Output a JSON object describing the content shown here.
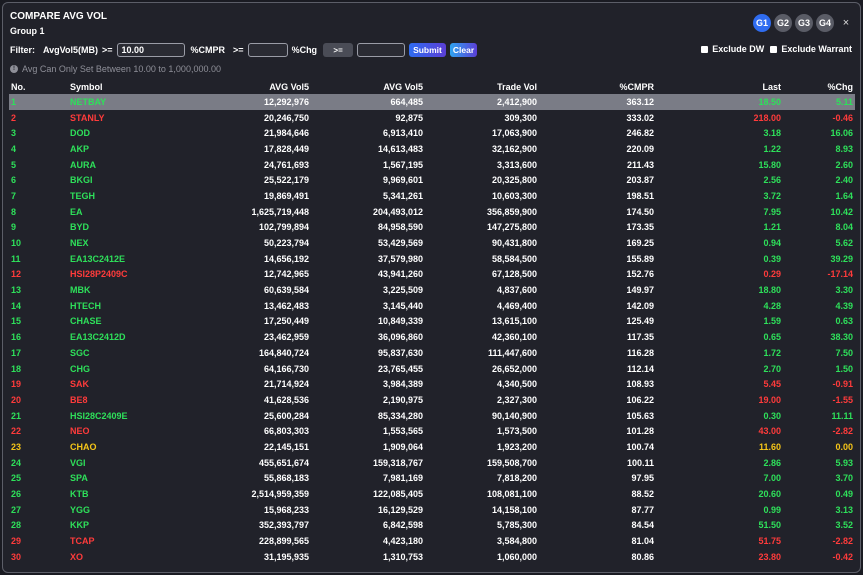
{
  "title": "COMPARE AVG VOL",
  "subtitle": "Group 1",
  "groups": [
    "G1",
    "G2",
    "G3",
    "G4"
  ],
  "close_icon": "×",
  "filter": {
    "label": "Filter:",
    "field1": "AvgVol5(MB)",
    "op1": ">=",
    "value1": "10.00",
    "field2": "%CMPR",
    "op2": ">=",
    "value2": "",
    "field3": "%Chg",
    "op3_btn": ">=",
    "value3": "",
    "submit": "Submit",
    "clear": "Clear"
  },
  "checks": {
    "dw": "Exclude DW",
    "warrant": "Exclude Warrant"
  },
  "hint": "Avg Can Only Set Between 10.00 to 1,000,000.00",
  "columns": [
    "No.",
    "Symbol",
    "AVG Vol5",
    "AVG Vol5",
    "Trade Vol",
    "%CMPR",
    "Last",
    "%Chg"
  ],
  "colors": {
    "up": "#2ee05a",
    "down": "#ff3b3b",
    "flat": "#f5c518"
  },
  "rows": [
    {
      "no": "1",
      "sym": "NETBAY",
      "a": "12,292,976",
      "b": "664,485",
      "t": "2,412,900",
      "c": "363.12",
      "last": "18.50",
      "chg": "5.11",
      "dir": "up"
    },
    {
      "no": "2",
      "sym": "STANLY",
      "a": "20,246,750",
      "b": "92,875",
      "t": "309,300",
      "c": "333.02",
      "last": "218.00",
      "chg": "-0.46",
      "dir": "down"
    },
    {
      "no": "3",
      "sym": "DOD",
      "a": "21,984,646",
      "b": "6,913,410",
      "t": "17,063,900",
      "c": "246.82",
      "last": "3.18",
      "chg": "16.06",
      "dir": "up"
    },
    {
      "no": "4",
      "sym": "AKP",
      "a": "17,828,449",
      "b": "14,613,483",
      "t": "32,162,900",
      "c": "220.09",
      "last": "1.22",
      "chg": "8.93",
      "dir": "up"
    },
    {
      "no": "5",
      "sym": "AURA",
      "a": "24,761,693",
      "b": "1,567,195",
      "t": "3,313,600",
      "c": "211.43",
      "last": "15.80",
      "chg": "2.60",
      "dir": "up"
    },
    {
      "no": "6",
      "sym": "BKGI",
      "a": "25,522,179",
      "b": "9,969,601",
      "t": "20,325,800",
      "c": "203.87",
      "last": "2.56",
      "chg": "2.40",
      "dir": "up"
    },
    {
      "no": "7",
      "sym": "TEGH",
      "a": "19,869,491",
      "b": "5,341,261",
      "t": "10,603,300",
      "c": "198.51",
      "last": "3.72",
      "chg": "1.64",
      "dir": "up"
    },
    {
      "no": "8",
      "sym": "EA",
      "a": "1,625,719,448",
      "b": "204,493,012",
      "t": "356,859,900",
      "c": "174.50",
      "last": "7.95",
      "chg": "10.42",
      "dir": "up"
    },
    {
      "no": "9",
      "sym": "BYD",
      "a": "102,799,894",
      "b": "84,958,590",
      "t": "147,275,800",
      "c": "173.35",
      "last": "1.21",
      "chg": "8.04",
      "dir": "up"
    },
    {
      "no": "10",
      "sym": "NEX",
      "a": "50,223,794",
      "b": "53,429,569",
      "t": "90,431,800",
      "c": "169.25",
      "last": "0.94",
      "chg": "5.62",
      "dir": "up"
    },
    {
      "no": "11",
      "sym": "EA13C2412E",
      "a": "14,656,192",
      "b": "37,579,980",
      "t": "58,584,500",
      "c": "155.89",
      "last": "0.39",
      "chg": "39.29",
      "dir": "up"
    },
    {
      "no": "12",
      "sym": "HSI28P2409C",
      "a": "12,742,965",
      "b": "43,941,260",
      "t": "67,128,500",
      "c": "152.76",
      "last": "0.29",
      "chg": "-17.14",
      "dir": "down"
    },
    {
      "no": "13",
      "sym": "MBK",
      "a": "60,639,584",
      "b": "3,225,509",
      "t": "4,837,600",
      "c": "149.97",
      "last": "18.80",
      "chg": "3.30",
      "dir": "up"
    },
    {
      "no": "14",
      "sym": "HTECH",
      "a": "13,462,483",
      "b": "3,145,440",
      "t": "4,469,400",
      "c": "142.09",
      "last": "4.28",
      "chg": "4.39",
      "dir": "up"
    },
    {
      "no": "15",
      "sym": "CHASE",
      "a": "17,250,449",
      "b": "10,849,339",
      "t": "13,615,100",
      "c": "125.49",
      "last": "1.59",
      "chg": "0.63",
      "dir": "up"
    },
    {
      "no": "16",
      "sym": "EA13C2412D",
      "a": "23,462,959",
      "b": "36,096,860",
      "t": "42,360,100",
      "c": "117.35",
      "last": "0.65",
      "chg": "38.30",
      "dir": "up"
    },
    {
      "no": "17",
      "sym": "SGC",
      "a": "164,840,724",
      "b": "95,837,630",
      "t": "111,447,600",
      "c": "116.28",
      "last": "1.72",
      "chg": "7.50",
      "dir": "up"
    },
    {
      "no": "18",
      "sym": "CHG",
      "a": "64,166,730",
      "b": "23,765,455",
      "t": "26,652,000",
      "c": "112.14",
      "last": "2.70",
      "chg": "1.50",
      "dir": "up"
    },
    {
      "no": "19",
      "sym": "SAK",
      "a": "21,714,924",
      "b": "3,984,389",
      "t": "4,340,500",
      "c": "108.93",
      "last": "5.45",
      "chg": "-0.91",
      "dir": "down"
    },
    {
      "no": "20",
      "sym": "BE8",
      "a": "41,628,536",
      "b": "2,190,975",
      "t": "2,327,300",
      "c": "106.22",
      "last": "19.00",
      "chg": "-1.55",
      "dir": "down"
    },
    {
      "no": "21",
      "sym": "HSI28C2409E",
      "a": "25,600,284",
      "b": "85,334,280",
      "t": "90,140,900",
      "c": "105.63",
      "last": "0.30",
      "chg": "11.11",
      "dir": "up"
    },
    {
      "no": "22",
      "sym": "NEO",
      "a": "66,803,303",
      "b": "1,553,565",
      "t": "1,573,500",
      "c": "101.28",
      "last": "43.00",
      "chg": "-2.82",
      "dir": "down"
    },
    {
      "no": "23",
      "sym": "CHAO",
      "a": "22,145,151",
      "b": "1,909,064",
      "t": "1,923,200",
      "c": "100.74",
      "last": "11.60",
      "chg": "0.00",
      "dir": "flat"
    },
    {
      "no": "24",
      "sym": "VGI",
      "a": "455,651,674",
      "b": "159,318,767",
      "t": "159,508,700",
      "c": "100.11",
      "last": "2.86",
      "chg": "5.93",
      "dir": "up"
    },
    {
      "no": "25",
      "sym": "SPA",
      "a": "55,868,183",
      "b": "7,981,169",
      "t": "7,818,200",
      "c": "97.95",
      "last": "7.00",
      "chg": "3.70",
      "dir": "up"
    },
    {
      "no": "26",
      "sym": "KTB",
      "a": "2,514,959,359",
      "b": "122,085,405",
      "t": "108,081,100",
      "c": "88.52",
      "last": "20.60",
      "chg": "0.49",
      "dir": "up"
    },
    {
      "no": "27",
      "sym": "YGG",
      "a": "15,968,233",
      "b": "16,129,529",
      "t": "14,158,100",
      "c": "87.77",
      "last": "0.99",
      "chg": "3.13",
      "dir": "up"
    },
    {
      "no": "28",
      "sym": "KKP",
      "a": "352,393,797",
      "b": "6,842,598",
      "t": "5,785,300",
      "c": "84.54",
      "last": "51.50",
      "chg": "3.52",
      "dir": "up"
    },
    {
      "no": "29",
      "sym": "TCAP",
      "a": "228,899,565",
      "b": "4,423,180",
      "t": "3,584,800",
      "c": "81.04",
      "last": "51.75",
      "chg": "-2.82",
      "dir": "down"
    },
    {
      "no": "30",
      "sym": "XO",
      "a": "31,195,935",
      "b": "1,310,753",
      "t": "1,060,000",
      "c": "80.86",
      "last": "23.80",
      "chg": "-0.42",
      "dir": "down"
    }
  ]
}
